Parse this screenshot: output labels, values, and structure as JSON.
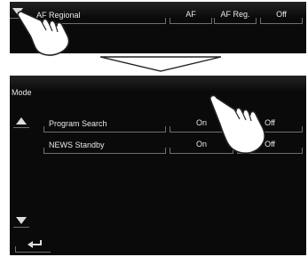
{
  "top": {
    "row_label": "AF Regional",
    "buttons": [
      "AF",
      "AF Reg.",
      "Off"
    ]
  },
  "bottom": {
    "title": "Mode",
    "rows": [
      {
        "label": "Program Search",
        "on": "On",
        "off": "Off"
      },
      {
        "label": "NEWS Standby",
        "on": "On",
        "off": "Off"
      }
    ]
  },
  "icons": {
    "up": "triangle-up-icon",
    "down": "triangle-down-icon",
    "back": "return-arrow-icon",
    "pointer": "pointing-hand-icon",
    "transition": "down-arrow-icon"
  }
}
